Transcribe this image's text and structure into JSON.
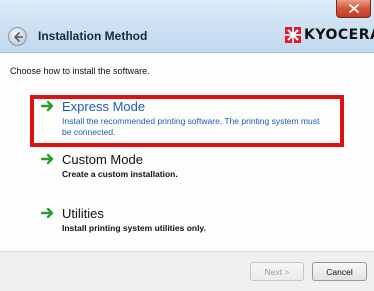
{
  "window": {
    "title": "Installation Method",
    "brand": "KYOCERA"
  },
  "instruction": "Choose how to install the software.",
  "options": [
    {
      "title": "Express Mode",
      "description_line1": "Install the recommended printing software. The printing system must",
      "description_line2": "be connected."
    },
    {
      "title": "Custom Mode",
      "description_line1": "Create a custom installation."
    },
    {
      "title": "Utilities",
      "description_line1": "Install printing system utilities only."
    }
  ],
  "buttons": {
    "next_label": "Next >",
    "cancel_label": "Cancel"
  },
  "colors": {
    "accent_arrow": "#2aa02a",
    "link_blue": "#1b5fae",
    "highlight_red": "#e01010",
    "close_red": "#d6543b"
  },
  "icons": [
    "back-arrow-icon",
    "close-icon",
    "kyocera-logo-icon",
    "green-arrow-icon"
  ]
}
